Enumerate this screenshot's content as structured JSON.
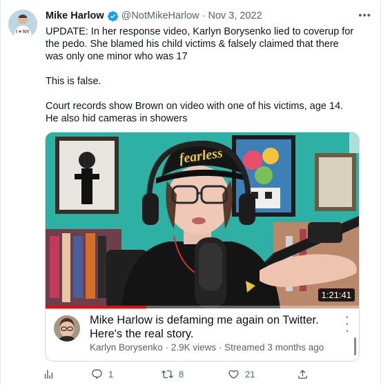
{
  "tweet": {
    "author_name": "Mike Harlow",
    "handle": "@NotMikeHarlow",
    "separator": "·",
    "date": "Nov 3, 2022",
    "more_icon": "more-horizontal-icon",
    "paragraphs": [
      "UPDATE: In her response video, Karlyn Borysenko lied to coverup for the pedo. She blamed his child victims & falsely claimed that there was only one minor who was 17",
      "This is false.",
      "Court records show Brown on video with one of his victims, age 14. He also hid cameras in showers"
    ]
  },
  "video_card": {
    "title": "Mike Harlow is defaming me again on Twitter. Here's the real story.",
    "channel": "Karlyn Borysenko",
    "views": "2.9K views",
    "meta_separator": "·",
    "streamed": "Streamed 3 months ago",
    "duration": "1:21:41",
    "progress": 0.32,
    "hat_text": "fearless"
  },
  "actions": {
    "views_icon": "analytics-icon",
    "reply_count": "1",
    "retweet_count": "8",
    "like_count": "21",
    "share_icon": "share-icon"
  },
  "colors": {
    "verified": "#1d9bf0",
    "secondary_text": "#536471",
    "progress": "#ff0000",
    "wall_teal": "#2fb0a4"
  }
}
